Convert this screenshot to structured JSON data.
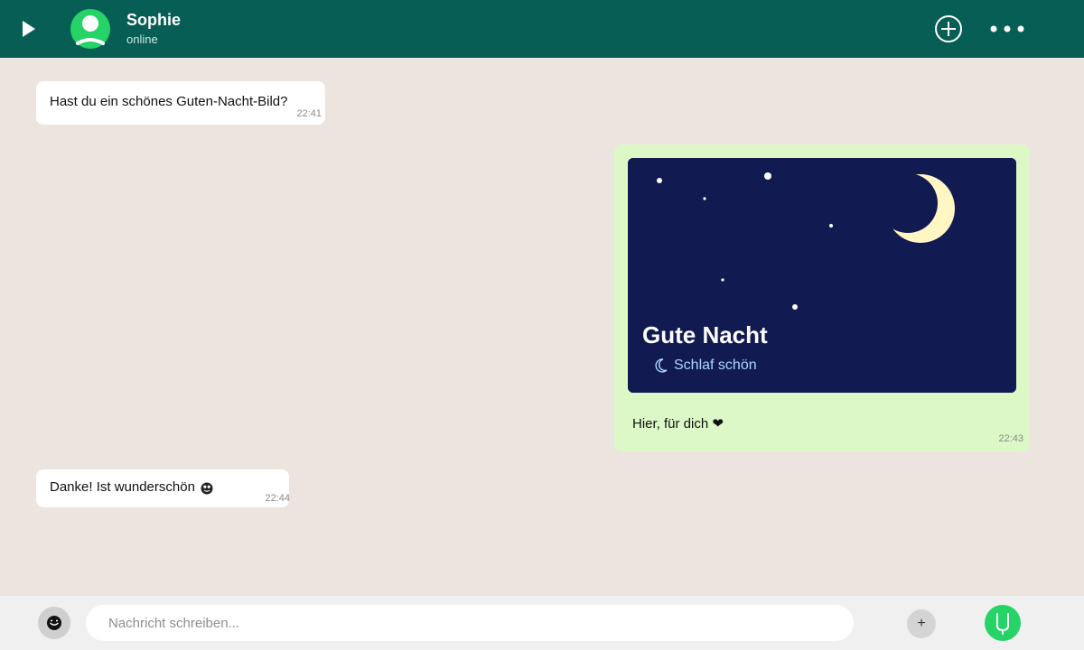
{
  "header": {
    "contact_name": "Sophie",
    "contact_status": "online",
    "icons": {
      "back": "play-triangle-icon",
      "avatar": "user-avatar-icon",
      "add": "plus-circle-icon",
      "more": "more-dots-icon"
    }
  },
  "messages": [
    {
      "direction": "incoming",
      "text": "Hast du ein schönes Guten-Nacht-Bild?",
      "time": "22:41"
    },
    {
      "direction": "outgoing",
      "image": {
        "title": "Gute Nacht",
        "subtitle": "Schlaf schön",
        "subtitle_icon": "crescent-moon-icon",
        "illustration": "night-sky-with-moon-and-stars"
      },
      "text": "Hier, für dich ❤",
      "time": "22:43"
    },
    {
      "direction": "incoming",
      "text": "Danke! Ist wunderschön",
      "emoji_icon": "smiling-face-emoji-icon",
      "time": "22:44"
    }
  ],
  "composer": {
    "placeholder": "Nachricht schreiben...",
    "value": "",
    "emoji_icon": "emoji-face-icon",
    "attach_label": "+",
    "send_icon": "microphone-icon"
  },
  "colors": {
    "header": "#075e54",
    "chat_background": "#ece5df",
    "incoming_bubble": "#ffffff",
    "outgoing_bubble": "#dcf8c6",
    "image_background": "#121a52",
    "moon": "#fff6c4",
    "send_button": "#25d366"
  }
}
